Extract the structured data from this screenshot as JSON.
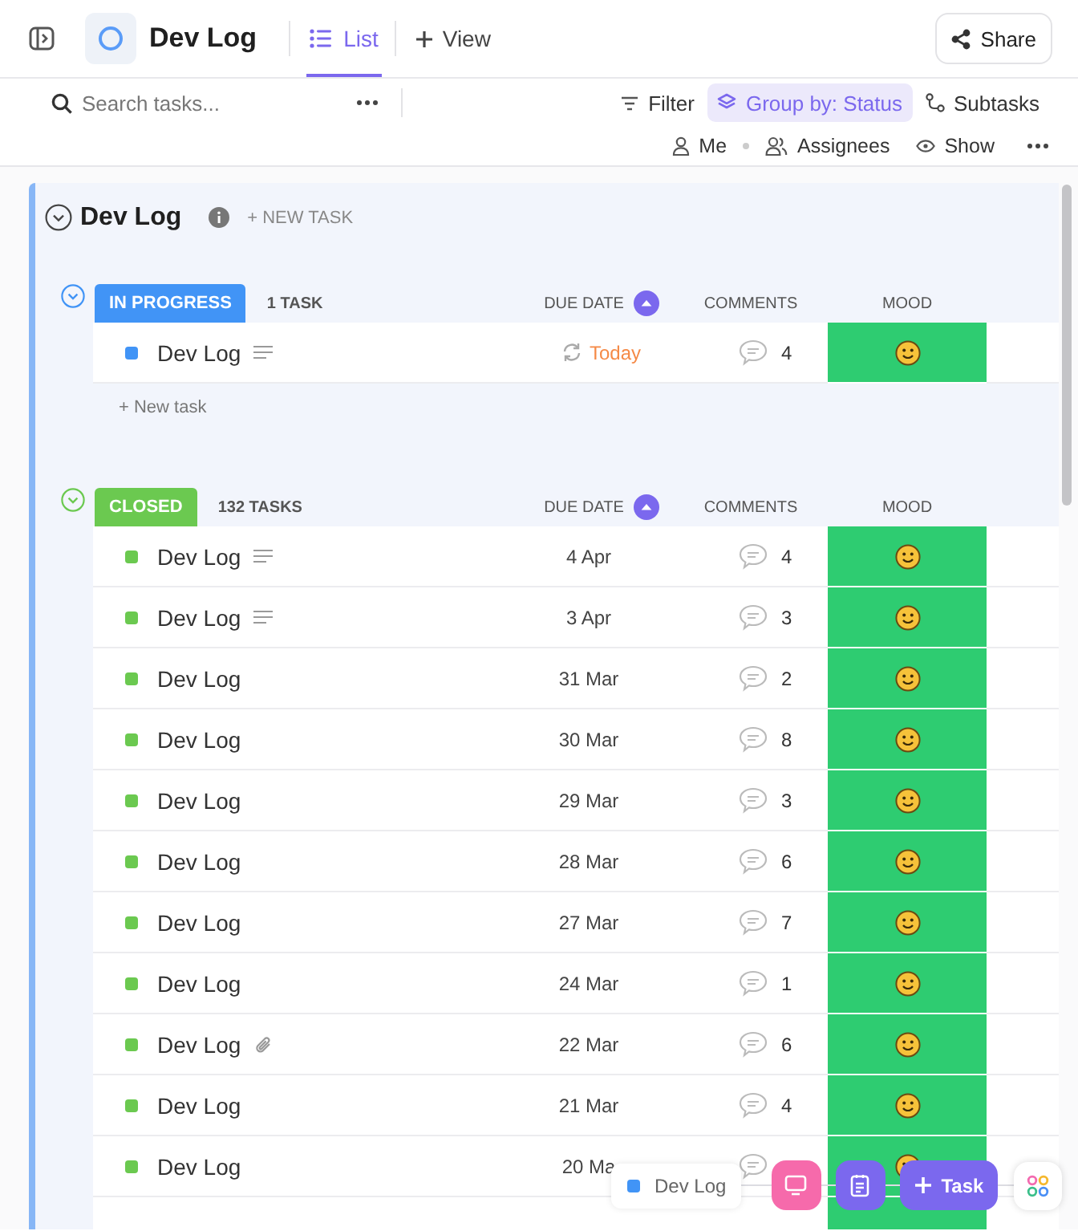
{
  "topbar": {
    "title": "Dev Log",
    "tabs": [
      {
        "label": "List",
        "selected": true
      }
    ],
    "add_view": "View",
    "share": "Share"
  },
  "toolbar": {
    "search_placeholder": "Search tasks...",
    "filter": "Filter",
    "group_by": "Group by: Status",
    "subtasks": "Subtasks",
    "me": "Me",
    "assignees": "Assignees",
    "show": "Show"
  },
  "list": {
    "title": "Dev Log",
    "new_task": "+ NEW TASK"
  },
  "groups": [
    {
      "status": "IN PROGRESS",
      "color": "#4194f6",
      "count": "1 TASK",
      "columns": [
        "DUE DATE",
        "COMMENTS",
        "MOOD"
      ],
      "new_task": "+ New task",
      "tasks": [
        {
          "name": "Dev Log",
          "has_description": true,
          "has_attachment": false,
          "due": "Today",
          "recurring": true,
          "due_today": true,
          "comments": "4"
        }
      ]
    },
    {
      "status": "CLOSED",
      "color": "#6bc950",
      "count": "132 TASKS",
      "columns": [
        "DUE DATE",
        "COMMENTS",
        "MOOD"
      ],
      "tasks": [
        {
          "name": "Dev Log",
          "has_description": true,
          "has_attachment": false,
          "due": "4 Apr",
          "recurring": false,
          "due_today": false,
          "comments": "4"
        },
        {
          "name": "Dev Log",
          "has_description": true,
          "has_attachment": false,
          "due": "3 Apr",
          "recurring": false,
          "due_today": false,
          "comments": "3"
        },
        {
          "name": "Dev Log",
          "has_description": false,
          "has_attachment": false,
          "due": "31 Mar",
          "recurring": false,
          "due_today": false,
          "comments": "2"
        },
        {
          "name": "Dev Log",
          "has_description": false,
          "has_attachment": false,
          "due": "30 Mar",
          "recurring": false,
          "due_today": false,
          "comments": "8"
        },
        {
          "name": "Dev Log",
          "has_description": false,
          "has_attachment": false,
          "due": "29 Mar",
          "recurring": false,
          "due_today": false,
          "comments": "3"
        },
        {
          "name": "Dev Log",
          "has_description": false,
          "has_attachment": false,
          "due": "28 Mar",
          "recurring": false,
          "due_today": false,
          "comments": "6"
        },
        {
          "name": "Dev Log",
          "has_description": false,
          "has_attachment": false,
          "due": "27 Mar",
          "recurring": false,
          "due_today": false,
          "comments": "7"
        },
        {
          "name": "Dev Log",
          "has_description": false,
          "has_attachment": false,
          "due": "24 Mar",
          "recurring": false,
          "due_today": false,
          "comments": "1"
        },
        {
          "name": "Dev Log",
          "has_description": false,
          "has_attachment": true,
          "due": "22 Mar",
          "recurring": false,
          "due_today": false,
          "comments": "6"
        },
        {
          "name": "Dev Log",
          "has_description": false,
          "has_attachment": false,
          "due": "21 Mar",
          "recurring": false,
          "due_today": false,
          "comments": "4"
        },
        {
          "name": "Dev Log",
          "has_description": false,
          "has_attachment": false,
          "due": "20 Ma",
          "recurring": false,
          "due_today": false
        }
      ]
    }
  ],
  "floating": {
    "chip": "Dev Log",
    "task_button": "Task"
  }
}
